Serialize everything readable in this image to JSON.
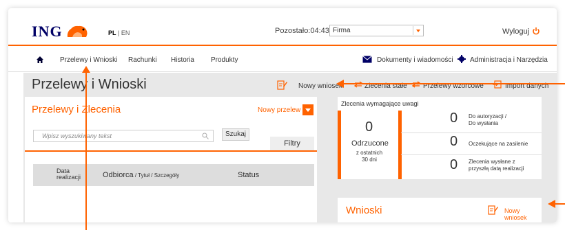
{
  "header": {
    "logo_text": "ING",
    "lang_pl": "PL",
    "lang_sep": " | ",
    "lang_en": "EN",
    "remaining": "Pozostało:04:43",
    "firm_select_value": "Firma",
    "logout": "Wyloguj"
  },
  "nav": {
    "items": [
      "Przelewy i Wnioski",
      "Rachunki",
      "Historia",
      "Produkty"
    ],
    "documents": "Dokumenty i wiadomości",
    "admin": "Administracja i Narzędzia"
  },
  "page": {
    "title": "Przelewy i Wnioski",
    "toolbar": {
      "new_request": "Nowy wniosek",
      "standing_orders": "Zlecenia stałe",
      "templates": "Przelewy wzorcowe",
      "import": "Import danych"
    }
  },
  "transfers_panel": {
    "title": "Przelewy i Zlecenia",
    "new_transfer": "Nowy przelew",
    "search_placeholder": "Wpisz wyszukiwany tekst",
    "search_button": "Szukaj",
    "filters": "Filtry",
    "columns": {
      "date": "Data realizacji",
      "recipient": "Odbiorca",
      "recipient_sub": " / Tytuł / Szczegóły",
      "status": "Status"
    }
  },
  "attention_panel": {
    "title": "Zlecenia wymagające uwagi",
    "rejected_count": "0",
    "rejected_label": "Odrzucone",
    "rejected_sub1": "z ostatnich",
    "rejected_sub2": "30 dni",
    "rows": [
      {
        "count": "0",
        "label1": "Do autoryzacji /",
        "label2": "Do wysłania"
      },
      {
        "count": "0",
        "label1": "Oczekujące na zasilenie",
        "label2": ""
      },
      {
        "count": "0",
        "label1": "Zlecenia wysłane z",
        "label2": "przyszłą datą realizacji"
      }
    ]
  },
  "requests_panel": {
    "title": "Wnioski",
    "new_request": "Nowy wniosek"
  },
  "colors": {
    "accent": "#ff6200",
    "brand_navy": "#000066",
    "panel_bg": "#e8e8e8"
  }
}
